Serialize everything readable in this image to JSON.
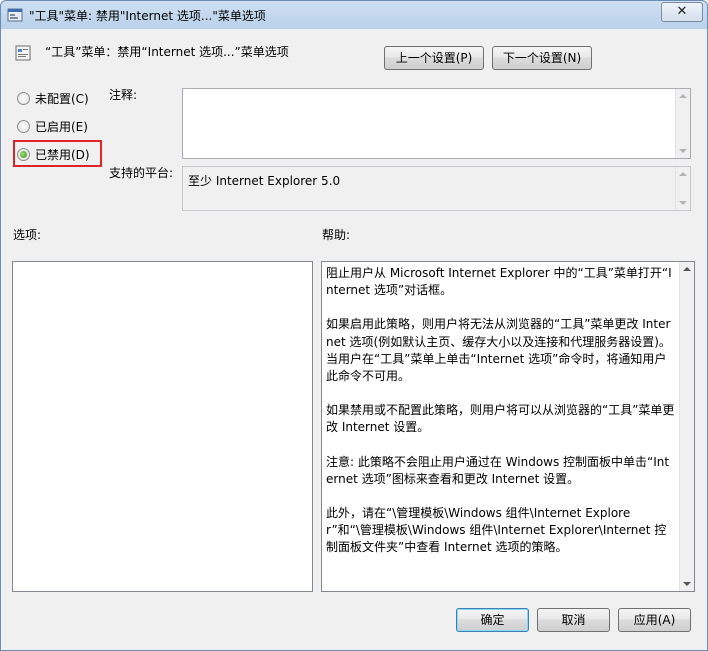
{
  "window": {
    "title": "\"工具\"菜单: 禁用\"Internet 选项...\"菜单选项",
    "close_label": "✕"
  },
  "header": {
    "policy_name": "“工具”菜单：禁用“Internet 选项...”菜单选项",
    "prev_button": "上一个设置(P)",
    "next_button": "下一个设置(N)"
  },
  "state": {
    "options": [
      {
        "label": "未配置(C)",
        "checked": false
      },
      {
        "label": "已启用(E)",
        "checked": false
      },
      {
        "label": "已禁用(D)",
        "checked": true
      }
    ]
  },
  "comment": {
    "label": "注释:",
    "value": ""
  },
  "platform": {
    "label": "支持的平台:",
    "value": "至少 Internet Explorer 5.0"
  },
  "options_label": "选项:",
  "help": {
    "label": "帮助:",
    "paragraphs": [
      "阻止用户从 Microsoft Internet Explorer 中的“工具”菜单打开“Internet 选项”对话框。",
      "如果启用此策略，则用户将无法从浏览器的“工具”菜单更改 Internet 选项(例如默认主页、缓存大小以及连接和代理服务器设置)。当用户在“工具”菜单上单击“Internet 选项”命令时，将通知用户此命令不可用。",
      "如果禁用或不配置此策略，则用户将可以从浏览器的“工具”菜单更改 Internet 设置。",
      "注意: 此策略不会阻止用户通过在 Windows 控制面板中单击“Internet 选项”图标来查看和更改 Internet 设置。",
      "此外，请在“\\管理模板\\Windows 组件\\Internet Explorer”和“\\管理模板\\Windows 组件\\Internet Explorer\\Internet 控制面板文件夹”中查看 Internet 选项的策略。"
    ]
  },
  "footer": {
    "ok": "确定",
    "cancel": "取消",
    "apply": "应用(A)"
  },
  "colors": {
    "highlight_box": "#e0242b",
    "radio_checked": "#2b8a1c"
  }
}
